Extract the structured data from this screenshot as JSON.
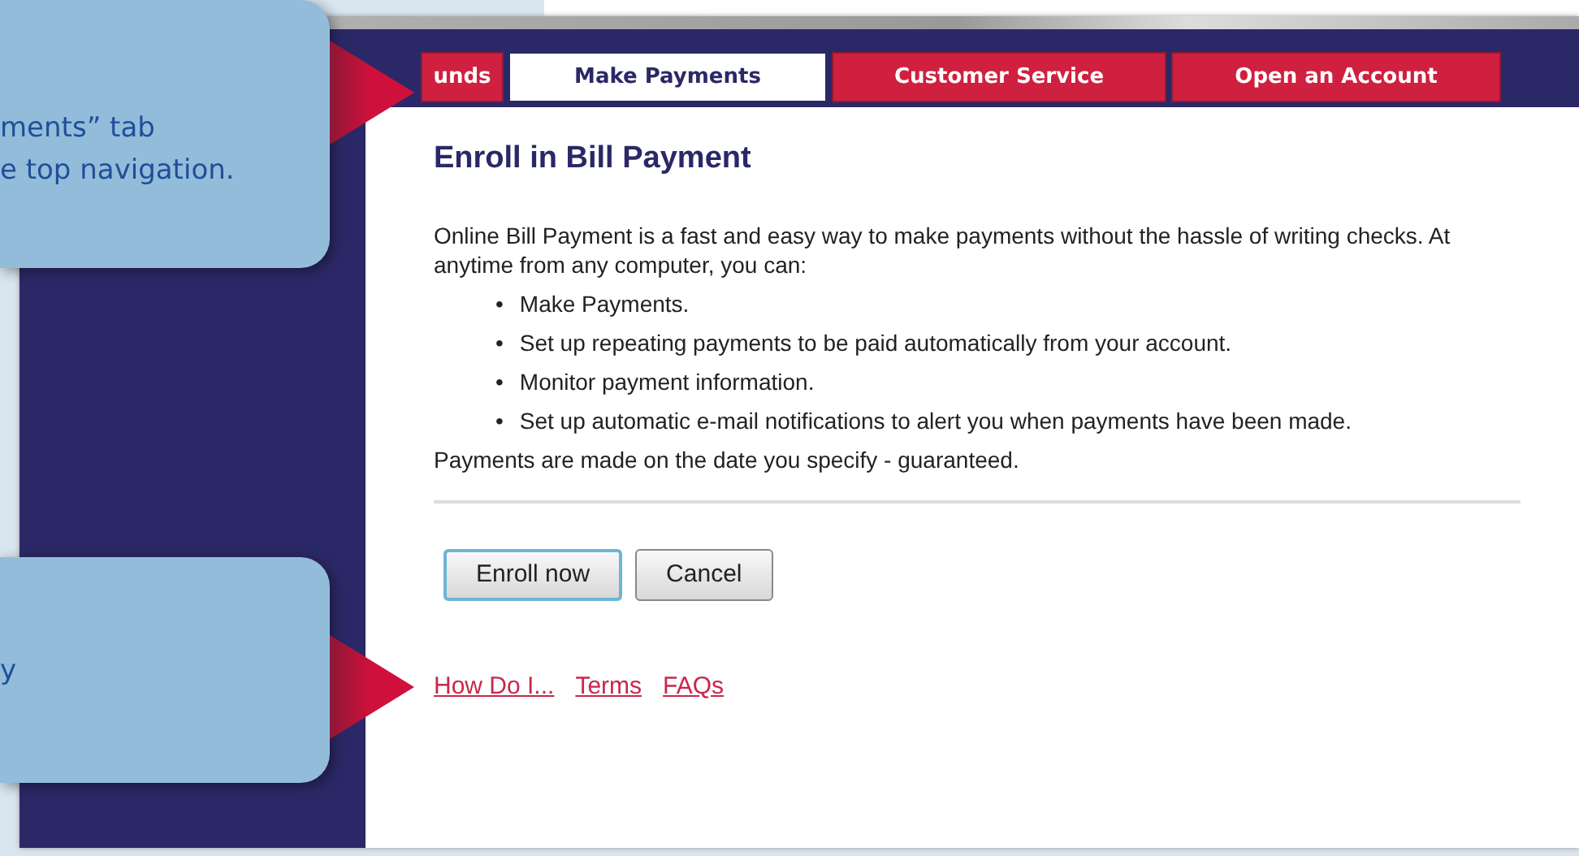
{
  "tabs": [
    {
      "label": "unds",
      "selected": false
    },
    {
      "label": "Make Payments",
      "selected": true
    },
    {
      "label": "Customer Service",
      "selected": false
    },
    {
      "label": "Open an Account",
      "selected": false
    }
  ],
  "heading": "Enroll in Bill Payment",
  "intro": "Online Bill Payment is a fast and easy way to make payments without the hassle of writing checks. At anytime from any computer, you can:",
  "bullets": [
    {
      "marker": "•",
      "text": "Make Payments."
    },
    {
      "marker": "•",
      "text": "Set up repeating payments to be paid automatically from your account."
    },
    {
      "marker": "•",
      "text": "Monitor payment information."
    },
    {
      "marker": "•",
      "text": "Set up automatic e-mail notifications to alert you when payments have been made."
    }
  ],
  "note": "Payments are made on the date you specify - guaranteed.",
  "buttons": [
    {
      "label": "Enroll now",
      "focused": true
    },
    {
      "label": "Cancel",
      "focused": false
    }
  ],
  "links": [
    "How Do I...",
    "Terms",
    "FAQs"
  ],
  "callouts": [
    {
      "lines": [
        "ments” tab",
        "e top navigation."
      ]
    },
    {
      "lines": [
        "y"
      ]
    }
  ]
}
